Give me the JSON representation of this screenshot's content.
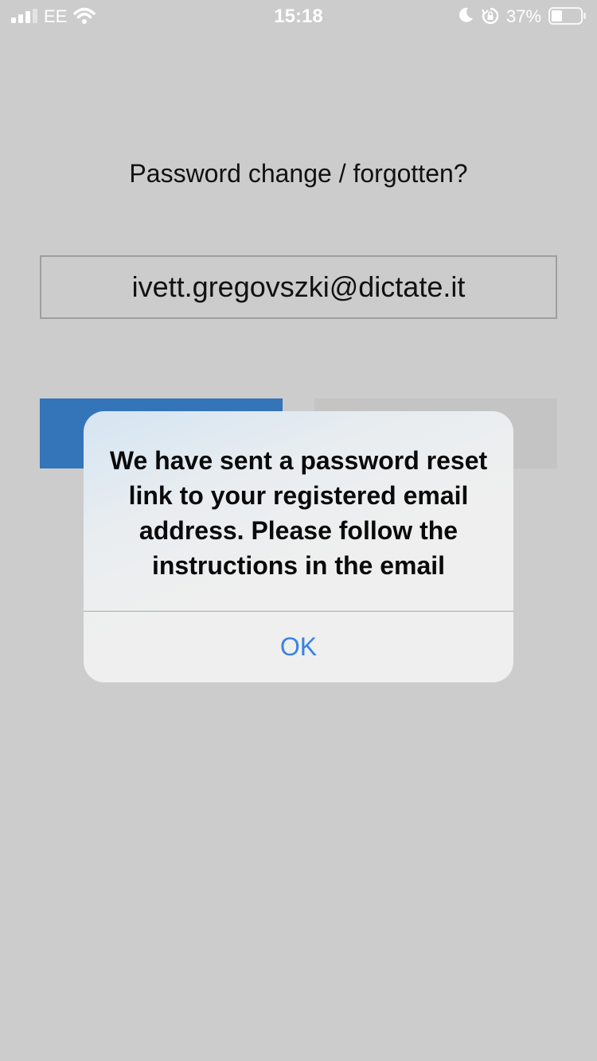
{
  "status_bar": {
    "carrier": "EE",
    "time": "15:18",
    "battery_percent": "37%",
    "battery_level": 0.37,
    "icons": [
      "signal-icon",
      "wifi-icon",
      "moon-icon",
      "orientation-lock-icon",
      "battery-icon"
    ]
  },
  "page": {
    "title": "Password change / forgotten?",
    "email_value": "ivett.gregovszki@dictate.it",
    "colors": {
      "background": "#cccccc",
      "primary_button": "#3474b8",
      "secondary_button": "#c4c4c4"
    }
  },
  "alert": {
    "message": "We have sent a password reset link to your registered email address. Please follow the instructions in the email",
    "ok_label": "OK",
    "ok_color": "#3a82e3"
  }
}
